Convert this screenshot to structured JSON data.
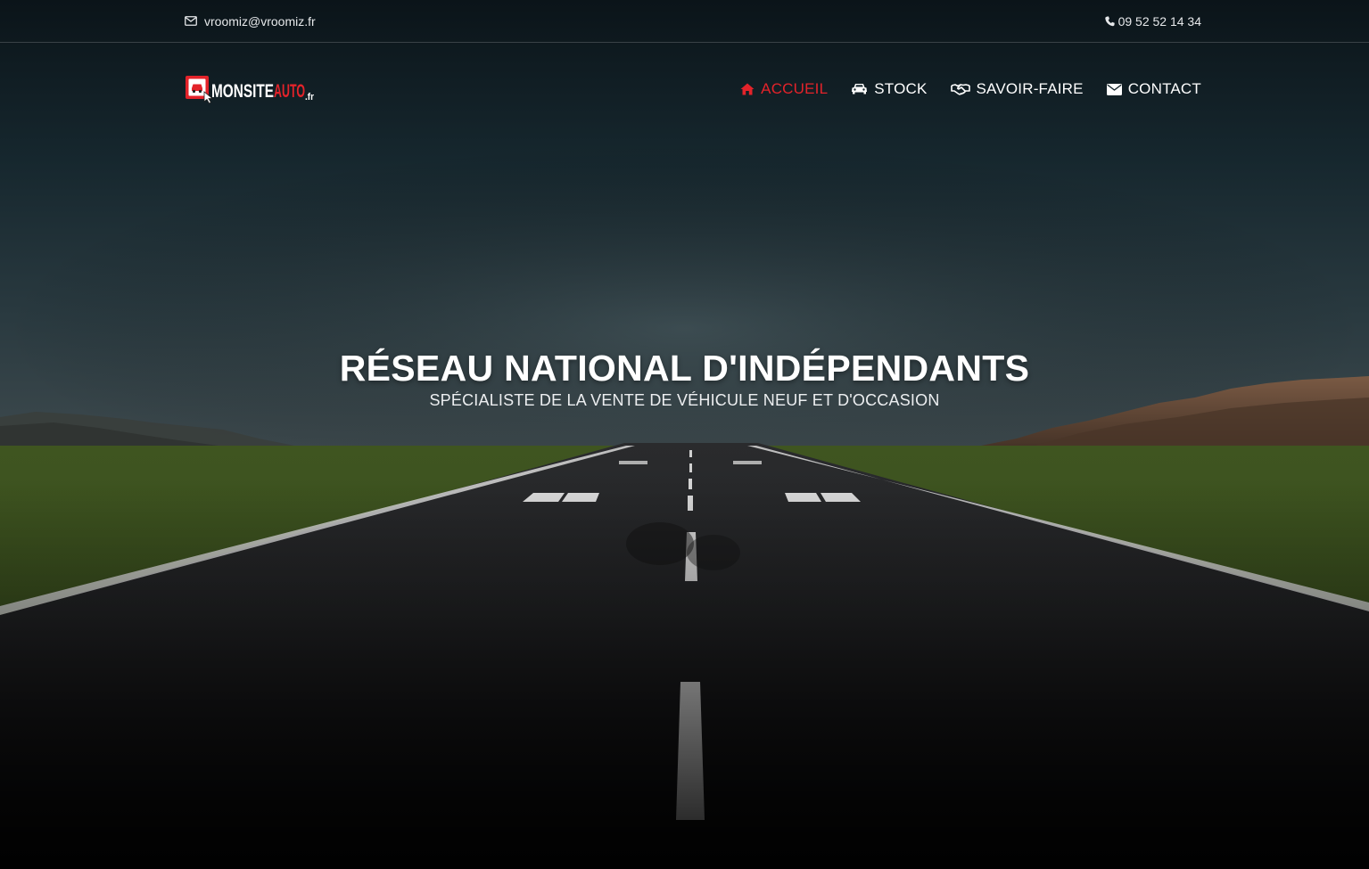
{
  "topbar": {
    "email": "vroomiz@vroomiz.fr",
    "email_icon": "envelope-outline-icon",
    "phone": "09 52 52 14 34",
    "phone_icon": "phone-icon"
  },
  "logo": {
    "text_main": "MONSITE",
    "text_accent": "AUTO",
    "text_suffix": ".fr",
    "icon": "car-screen-cursor-icon"
  },
  "nav": {
    "items": [
      {
        "label": "ACCUEIL",
        "icon": "home-icon",
        "active": true
      },
      {
        "label": "STOCK",
        "icon": "car-icon",
        "active": false
      },
      {
        "label": "SAVOIR-FAIRE",
        "icon": "handshake-icon",
        "active": false
      },
      {
        "label": "CONTACT",
        "icon": "envelope-icon",
        "active": false
      }
    ]
  },
  "hero": {
    "title": "RÉSEAU NATIONAL D'INDÉPENDANTS",
    "subtitle": "SPÉCIALISTE DE LA VENTE DE VÉHICULE NEUF ET D'OCCASION"
  },
  "colors": {
    "accent": "#e3232a",
    "sky_top": "#0c1a22",
    "grass": "#4d6a24",
    "asphalt": "#1c1c1e"
  }
}
